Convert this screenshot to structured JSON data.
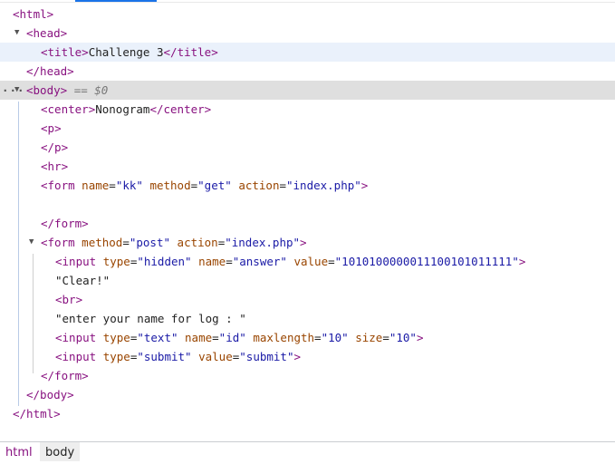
{
  "lines": {
    "l1": "html",
    "l2": "head",
    "l3_tag": "title",
    "l3_text": "Challenge 3",
    "l4": "/head",
    "l5_tag": "body",
    "l5_eq": "== $0",
    "l6_tag": "center",
    "l6_text": "Nonogram",
    "l7": "p",
    "l8": "/p",
    "l9": "hr",
    "l10_tag": "form",
    "l10_attr1": "name",
    "l10_val1": "\"kk\"",
    "l10_attr2": "method",
    "l10_val2": "\"get\"",
    "l10_attr3": "action",
    "l10_val3": "\"index.php\"",
    "l11": "/form",
    "l12_tag": "form",
    "l12_attr1": "method",
    "l12_val1": "\"post\"",
    "l12_attr2": "action",
    "l12_val2": "\"index.php\"",
    "l13_tag": "input",
    "l13_attr1": "type",
    "l13_val1": "\"hidden\"",
    "l13_attr2": "name",
    "l13_val2": "\"answer\"",
    "l13_attr3": "value",
    "l13_val3": "\"1010100000011100101011111\"",
    "l14": "\"Clear!\"",
    "l15": "br",
    "l16": "\"enter your name for log : \"",
    "l17_tag": "input",
    "l17_attr1": "type",
    "l17_val1": "\"text\"",
    "l17_attr2": "name",
    "l17_val2": "\"id\"",
    "l17_attr3": "maxlength",
    "l17_val3": "\"10\"",
    "l17_attr4": "size",
    "l17_val4": "\"10\"",
    "l18_tag": "input",
    "l18_attr1": "type",
    "l18_val1": "\"submit\"",
    "l18_attr2": "value",
    "l18_val2": "\"submit\"",
    "l19": "/form",
    "l20": "/body",
    "l21": "/html"
  },
  "breadcrumb": {
    "html": "html",
    "body": "body"
  }
}
